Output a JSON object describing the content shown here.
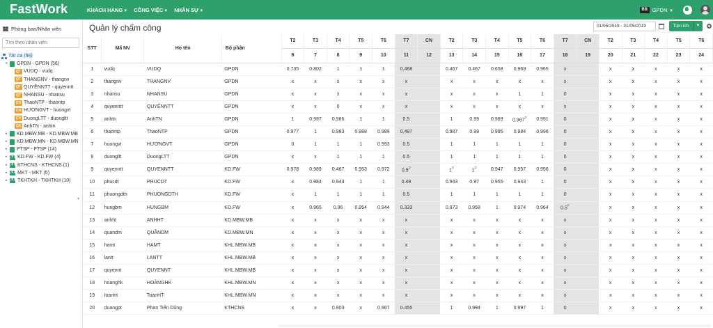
{
  "app": {
    "logo": "FastWork",
    "nav": [
      "KHÁCH HÀNG",
      "CÔNG VIỆC",
      "NHÂN SỰ"
    ],
    "company_badge": "BB",
    "company": "GPDN"
  },
  "sidebar": {
    "title": "Phòng ban/Nhân viên",
    "search_placeholder": "Tìm theo nhân viên",
    "tree": [
      {
        "level": 0,
        "kind": "all",
        "label": "Tất cả (56)"
      },
      {
        "level": 1,
        "kind": "dept",
        "label": "GPDN - GPDN (56)",
        "open": true
      },
      {
        "level": 2,
        "kind": "role",
        "badge": "QT",
        "label": "VUDQ - vudq"
      },
      {
        "level": 2,
        "kind": "role",
        "badge": "QT",
        "label": "THANGNV - thangnv"
      },
      {
        "level": 2,
        "kind": "role",
        "badge": "QT",
        "label": "QUYỀNNTT - quyenntt"
      },
      {
        "level": 2,
        "kind": "role",
        "badge": "QT",
        "label": "NHANSU - nhansu"
      },
      {
        "level": 2,
        "kind": "role",
        "badge": "CH",
        "label": "ThaoNTP - thaontp"
      },
      {
        "level": 2,
        "kind": "role",
        "badge": "CH",
        "label": "HƯƠNGVT - huongvt"
      },
      {
        "level": 2,
        "kind": "role",
        "badge": "CH",
        "label": "DuongLTT - duongltt"
      },
      {
        "level": 2,
        "kind": "role",
        "badge": "QS",
        "label": "AnhTN - anhtn"
      },
      {
        "level": 1,
        "kind": "dept",
        "label": "KD.MBW.MB - KD.MBW.MB"
      },
      {
        "level": 1,
        "kind": "dept",
        "label": "KD.MBW.MN - KD.MBW.MN"
      },
      {
        "level": 1,
        "kind": "dept",
        "label": "PTSP - PTSP (14)"
      },
      {
        "level": 1,
        "kind": "team",
        "label": "KD.FW - KD.FW (4)"
      },
      {
        "level": 1,
        "kind": "team",
        "label": "KTHCNS - KTHCNS (1)"
      },
      {
        "level": 1,
        "kind": "team",
        "label": "MKT - MKT (5)"
      },
      {
        "level": 1,
        "kind": "team",
        "label": "TKHTKH - TKHTKH (10)"
      }
    ]
  },
  "page": {
    "title": "Quản lý chấm công",
    "date_range": "01/05/2019 - 31/05/2019",
    "tools_label": "Tiện ích"
  },
  "table": {
    "col_stt": "STT",
    "col_code": "Mã NV",
    "col_name": "Họ tên",
    "col_dept": "Bộ phận",
    "day_names": [
      "T2",
      "T3",
      "T4",
      "T5",
      "T6",
      "T7",
      "CN",
      "T2",
      "T3",
      "T4",
      "T5",
      "T6",
      "T7",
      "CN",
      "T2",
      "T3",
      "T4",
      "T5",
      "T6"
    ],
    "day_nums": [
      "6",
      "7",
      "8",
      "9",
      "10",
      "11",
      "12",
      "13",
      "14",
      "15",
      "16",
      "17",
      "18",
      "19",
      "20",
      "21",
      "22",
      "23",
      "24"
    ],
    "rows": [
      {
        "stt": "1",
        "code": "vudq",
        "name": "VUDQ",
        "dept": "GPDN",
        "days": [
          "0.735",
          "0.802",
          "1",
          "1",
          "1",
          "0.468",
          "",
          "0.467",
          "0.467",
          "0.658",
          "0.969",
          "0.965",
          "x",
          "",
          "x",
          "x",
          "x",
          "x",
          "x"
        ]
      },
      {
        "stt": "2",
        "code": "thangnv",
        "name": "THANGNV",
        "dept": "GPDN",
        "days": [
          "x",
          "x",
          "x",
          "x",
          "x",
          "x",
          "",
          "x",
          "x",
          "x",
          "x",
          "x",
          "x",
          "",
          "x",
          "x",
          "x",
          "x",
          "x"
        ]
      },
      {
        "stt": "3",
        "code": "nhansu",
        "name": "NHANSU",
        "dept": "GPDN",
        "days": [
          "x",
          "x",
          "x",
          "x",
          "x",
          "x",
          "",
          "x",
          "x",
          "x",
          "1",
          "1",
          "0",
          "",
          "x",
          "x",
          "x",
          "x",
          "x"
        ]
      },
      {
        "stt": "4",
        "code": "quyenntt",
        "name": "QUYÊNNTT",
        "dept": "GPDN",
        "days": [
          "x",
          "x",
          "0",
          "x",
          "x",
          "x",
          "",
          "x",
          "x",
          "x",
          "x",
          "x",
          "x",
          "",
          "x",
          "x",
          "x",
          "x",
          "x"
        ]
      },
      {
        "stt": "5",
        "code": "anhtn",
        "name": "AnhTN",
        "dept": "GPDN",
        "days": [
          "1",
          "0.997",
          "0.986",
          "1",
          "1",
          "0.5",
          "",
          "1",
          "0.99",
          "0.989",
          "0.967P",
          "0.991",
          "0",
          "",
          "x",
          "x",
          "x",
          "x",
          "x"
        ]
      },
      {
        "stt": "6",
        "code": "thaontp",
        "name": "ThaoNTP",
        "dept": "GPDN",
        "days": [
          "0.977",
          "1",
          "0.983",
          "0.988",
          "0.989",
          "0.487",
          "",
          "0.987",
          "0.99",
          "0.995",
          "0.984",
          "0.996",
          "0",
          "",
          "x",
          "x",
          "x",
          "x",
          "x"
        ]
      },
      {
        "stt": "7",
        "code": "huongvt",
        "name": "HƯƠNGVT",
        "dept": "GPDN",
        "days": [
          "0",
          "1",
          "1",
          "1",
          "0.993",
          "0.5",
          "",
          "1",
          "1",
          "1",
          "1",
          "1",
          "0",
          "",
          "x",
          "x",
          "x",
          "x",
          "x"
        ]
      },
      {
        "stt": "8",
        "code": "duongltt",
        "name": "DuongLTT",
        "dept": "GPDN",
        "days": [
          "x",
          "x",
          "1",
          "1",
          "1",
          "0.5",
          "",
          "1",
          "1",
          "1",
          "1",
          "1",
          "0",
          "",
          "x",
          "x",
          "x",
          "x",
          "x"
        ]
      },
      {
        "stt": "9",
        "code": "quyenntt",
        "name": "QUYENNTT",
        "dept": "KD.FW",
        "days": [
          "0.978",
          "0.989",
          "0.467",
          "0.953",
          "0.972",
          "0.5P",
          "",
          "1P",
          "1P",
          "0.947",
          "0.957",
          "0.956",
          "0",
          "",
          "x",
          "x",
          "x",
          "x",
          "x"
        ]
      },
      {
        "stt": "10",
        "code": "phucdt",
        "name": "PHUCDT",
        "dept": "KD.FW",
        "days": [
          "x",
          "0.984",
          "0.943",
          "1",
          "1",
          "0.49",
          "",
          "0.943",
          "0.97",
          "0.955",
          "0.943",
          "1",
          "0",
          "",
          "x",
          "x",
          "x",
          "x",
          "x"
        ]
      },
      {
        "stt": "11",
        "code": "phuongdth",
        "name": "PHUONGDTH",
        "dept": "KD.FW",
        "days": [
          "x",
          "1",
          "1",
          "1",
          "1",
          "0.5",
          "",
          "1",
          "1",
          "1",
          "1",
          "1",
          "0",
          "",
          "x",
          "x",
          "x",
          "x",
          "x"
        ]
      },
      {
        "stt": "12",
        "code": "hungbm",
        "name": "HUNGBM",
        "dept": "KD.FW",
        "days": [
          "x",
          "0.965",
          "0.96",
          "0.954",
          "0.944",
          "0.333",
          "",
          "0.973",
          "0.958",
          "1",
          "0.974",
          "0.964",
          "0.5P",
          "",
          "x",
          "x",
          "x",
          "x",
          "x"
        ]
      },
      {
        "stt": "13",
        "code": "anhht",
        "name": "ANHHT",
        "dept": "KD.MBW.MB",
        "days": [
          "x",
          "x",
          "x",
          "x",
          "x",
          "x",
          "",
          "x",
          "x",
          "x",
          "x",
          "x",
          "x",
          "",
          "x",
          "x",
          "x",
          "x",
          "x"
        ]
      },
      {
        "stt": "14",
        "code": "quandm",
        "name": "QUÂNDM",
        "dept": "KD.MBW.MN",
        "days": [
          "x",
          "x",
          "x",
          "x",
          "x",
          "x",
          "",
          "x",
          "x",
          "x",
          "x",
          "x",
          "x",
          "",
          "x",
          "x",
          "x",
          "x",
          "x"
        ]
      },
      {
        "stt": "15",
        "code": "hamt",
        "name": "HAMT",
        "dept": "KHL.MBW.MB",
        "days": [
          "x",
          "x",
          "x",
          "x",
          "x",
          "x",
          "",
          "x",
          "x",
          "x",
          "x",
          "x",
          "x",
          "",
          "x",
          "x",
          "x",
          "x",
          "x"
        ]
      },
      {
        "stt": "16",
        "code": "lantt",
        "name": "LANTT",
        "dept": "KHL.MBW.MB",
        "days": [
          "x",
          "x",
          "x",
          "x",
          "x",
          "x",
          "",
          "x",
          "x",
          "x",
          "x",
          "x",
          "x",
          "",
          "x",
          "x",
          "x",
          "x",
          "x"
        ]
      },
      {
        "stt": "17",
        "code": "quyennt",
        "name": "QUYENNT",
        "dept": "KHL.MBW.MB",
        "days": [
          "x",
          "x",
          "x",
          "x",
          "x",
          "x",
          "",
          "x",
          "x",
          "x",
          "x",
          "x",
          "x",
          "",
          "x",
          "x",
          "x",
          "x",
          "x"
        ]
      },
      {
        "stt": "18",
        "code": "hoanghk",
        "name": "HOÀNGHK",
        "dept": "KHL.MBW.MN",
        "days": [
          "x",
          "x",
          "x",
          "x",
          "x",
          "x",
          "",
          "x",
          "x",
          "x",
          "x",
          "x",
          "x",
          "",
          "x",
          "x",
          "x",
          "x",
          "x"
        ]
      },
      {
        "stt": "19",
        "code": "toanht",
        "name": "ToanHT",
        "dept": "KHL.MBW.MN",
        "days": [
          "x",
          "x",
          "x",
          "x",
          "x",
          "x",
          "",
          "x",
          "x",
          "x",
          "x",
          "x",
          "x",
          "",
          "x",
          "x",
          "x",
          "x",
          "x"
        ]
      },
      {
        "stt": "20",
        "code": "duangpt",
        "name": "Phan Tiến Dũng",
        "dept": "KTHCNS",
        "days": [
          "x",
          "x",
          "0.903",
          "x",
          "0.987",
          "0.455",
          "",
          "1",
          "0.994",
          "1",
          "0.997",
          "1",
          "0",
          "",
          "x",
          "x",
          "x",
          "x",
          "x"
        ]
      }
    ]
  }
}
